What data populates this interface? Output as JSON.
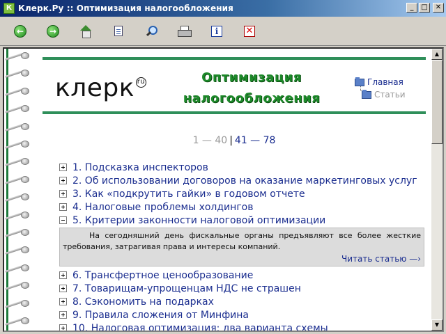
{
  "window": {
    "title": "Клерк.Ру :: Оптимизация налогообложения",
    "buttons": {
      "minimize": "_",
      "maximize": "□",
      "close": "✕"
    }
  },
  "toolbar": {
    "tools": [
      {
        "name": "back",
        "icon": "back-arrow-icon"
      },
      {
        "name": "forward",
        "icon": "forward-arrow-icon"
      },
      {
        "name": "home",
        "icon": "home-icon"
      },
      {
        "name": "page",
        "icon": "document-icon"
      },
      {
        "name": "search",
        "icon": "search-icon"
      },
      {
        "name": "print",
        "icon": "printer-icon"
      },
      {
        "name": "info",
        "icon": "info-icon"
      },
      {
        "name": "close",
        "icon": "close-icon"
      }
    ],
    "back_glyph": "←",
    "forward_glyph": "→",
    "info_glyph": "i",
    "close_glyph": "✕"
  },
  "header": {
    "logo": "клерк",
    "logo_mark": "ru",
    "title": "Оптимизация налогообложения",
    "nav_home": "Главная",
    "nav_articles": "Статьи"
  },
  "pager": {
    "inactive": "1 — 40",
    "separator": "|",
    "active": "41 — 78"
  },
  "articles": [
    {
      "label": "1. Подсказка инспекторов",
      "expanded": false
    },
    {
      "label": "2. Об использовании договоров на оказание маркетинговых услуг",
      "expanded": false
    },
    {
      "label": "3. Как «подкрутить гайки» в годовом отчете",
      "expanded": false
    },
    {
      "label": "4. Налоговые проблемы холдингов",
      "expanded": false
    },
    {
      "label": "5. Критерии законности налоговой оптимизации",
      "expanded": true
    },
    {
      "label": "6. Трансфертное ценообразование",
      "expanded": false
    },
    {
      "label": "7. Товарищам-упрощенцам НДС не страшен",
      "expanded": false
    },
    {
      "label": "8. Сэкономить на подарках",
      "expanded": false
    },
    {
      "label": "9. Правила сложения от Минфина",
      "expanded": false
    },
    {
      "label": "10. Налоговая оптимизация: два варианта схемы",
      "expanded": false
    }
  ],
  "expanded_article": {
    "description": "На сегодняшний день фискальные органы предъявляют все более жесткие требования, затрагивая права и интересы компаний.",
    "read_link": "Читать статью —›"
  },
  "scrollbar": {
    "up": "▲",
    "down": "▼"
  }
}
